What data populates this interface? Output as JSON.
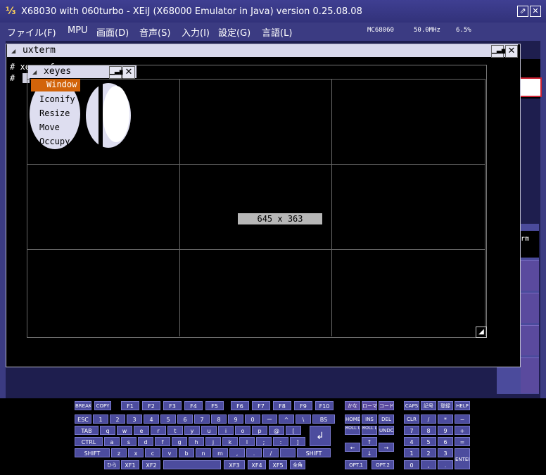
{
  "window": {
    "title": "X68030 with 060turbo - XEiJ (X68000 Emulator in Java) version 0.25.08.08",
    "icon": "xeij-app-icon",
    "restore_label": "⇗",
    "close_label": "✕"
  },
  "menubar": {
    "items": [
      "ファイル(F)",
      "MPU",
      "画面(D)",
      "音声(S)",
      "入力(I)",
      "設定(G)",
      "言語(L)"
    ],
    "cpu": "MC68060",
    "clock": "50.0MHz",
    "load": "6.5%"
  },
  "uxterm": {
    "title": "uxterm",
    "lines": [
      "# xeyes &",
      "# "
    ]
  },
  "xeyes": {
    "title": "xeyes",
    "menu": [
      "Window",
      "Iconify",
      "Resize",
      "Move",
      "Occupy"
    ],
    "geometry": "645 x 363"
  },
  "side_term_label": "rm",
  "keyboard": {
    "row0": [
      "BREAK",
      "COPY",
      "F1",
      "F2",
      "F3",
      "F4",
      "F5",
      "F6",
      "F7",
      "F8",
      "F9",
      "F10",
      "かな",
      "ローマ",
      "コード",
      "CAPS",
      "記号",
      "登録",
      "HELP"
    ],
    "row1": [
      "ESC",
      "1",
      "2",
      "3",
      "4",
      "5",
      "6",
      "7",
      "8",
      "9",
      "0",
      "ー",
      "^",
      "\\",
      "BS",
      "HOME",
      "INS",
      "DEL",
      "CLR",
      "/",
      "*",
      "−"
    ],
    "row2": [
      "TAB",
      "q",
      "w",
      "e",
      "r",
      "t",
      "y",
      "u",
      "i",
      "o",
      "p",
      "@",
      "[",
      "↲",
      "ROLL UP",
      "ROLL DOWN",
      "UNDO",
      "7",
      "8",
      "9",
      "+"
    ],
    "row3": [
      "CTRL",
      "a",
      "s",
      "d",
      "f",
      "g",
      "h",
      "j",
      "k",
      "l",
      ";",
      ":",
      "]",
      "↑",
      "4",
      "5",
      "6",
      "="
    ],
    "row4": [
      "SHIFT",
      "z",
      "x",
      "c",
      "v",
      "b",
      "n",
      "m",
      ",",
      ".",
      "/",
      "",
      "SHIFT",
      "←",
      "→",
      "1",
      "2",
      "3"
    ],
    "row5": [
      "ひら",
      "XF1",
      "XF2",
      "",
      "XF3",
      "XF4",
      "XF5",
      "全角",
      "OPT.1",
      "↓",
      "OPT.2",
      "0",
      ",",
      ".",
      "ENTER"
    ]
  }
}
